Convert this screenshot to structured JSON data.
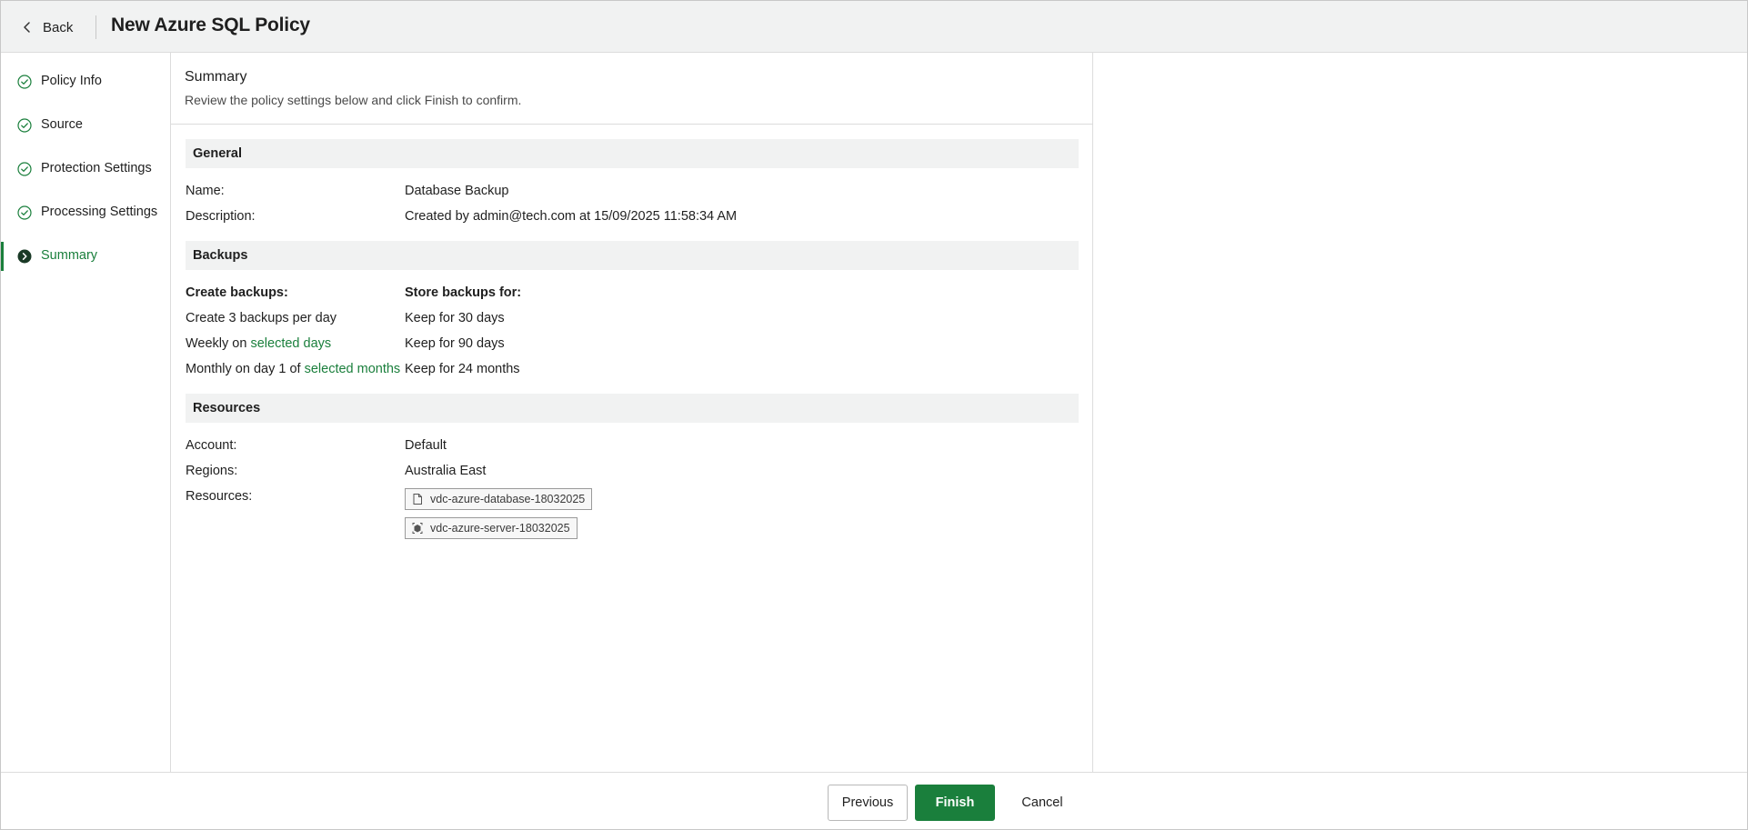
{
  "header": {
    "back_label": "Back",
    "title": "New Azure SQL Policy"
  },
  "sidebar": {
    "steps": [
      {
        "label": "Policy Info",
        "state": "completed"
      },
      {
        "label": "Source",
        "state": "completed"
      },
      {
        "label": "Protection Settings",
        "state": "completed"
      },
      {
        "label": "Processing Settings",
        "state": "completed"
      },
      {
        "label": "Summary",
        "state": "current"
      }
    ]
  },
  "summary": {
    "title": "Summary",
    "subtitle": "Review the policy settings below and click Finish to confirm."
  },
  "general": {
    "heading": "General",
    "name_label": "Name:",
    "name_value": "Database Backup",
    "description_label": "Description:",
    "description_value": "Created by admin@tech.com at 15/09/2025 11:58:34 AM"
  },
  "backups": {
    "heading": "Backups",
    "create_header": "Create backups:",
    "store_header": "Store backups for:",
    "daily_text": "Create 3 backups per day",
    "weekly_prefix": "Weekly on",
    "weekly_link": "selected days",
    "monthly_prefix": "Monthly on day 1 of",
    "monthly_link": "selected months",
    "daily_retention": "Keep for 30 days",
    "weekly_retention": "Keep for 90 days",
    "monthly_retention": "Keep for 24 months"
  },
  "resources": {
    "heading": "Resources",
    "account_label": "Account:",
    "account_value": "Default",
    "regions_label": "Regions:",
    "regions_value": "Australia East",
    "resources_label": "Resources:",
    "items": [
      {
        "name": "vdc-azure-database-18032025",
        "icon": "database-file-icon"
      },
      {
        "name": "vdc-azure-server-18032025",
        "icon": "server-icon"
      }
    ]
  },
  "footer": {
    "previous_label": "Previous",
    "finish_label": "Finish",
    "cancel_label": "Cancel"
  },
  "colors": {
    "accent": "#1a7f3c",
    "header_bg": "#f1f2f2",
    "section_bg": "#f1f2f2"
  }
}
